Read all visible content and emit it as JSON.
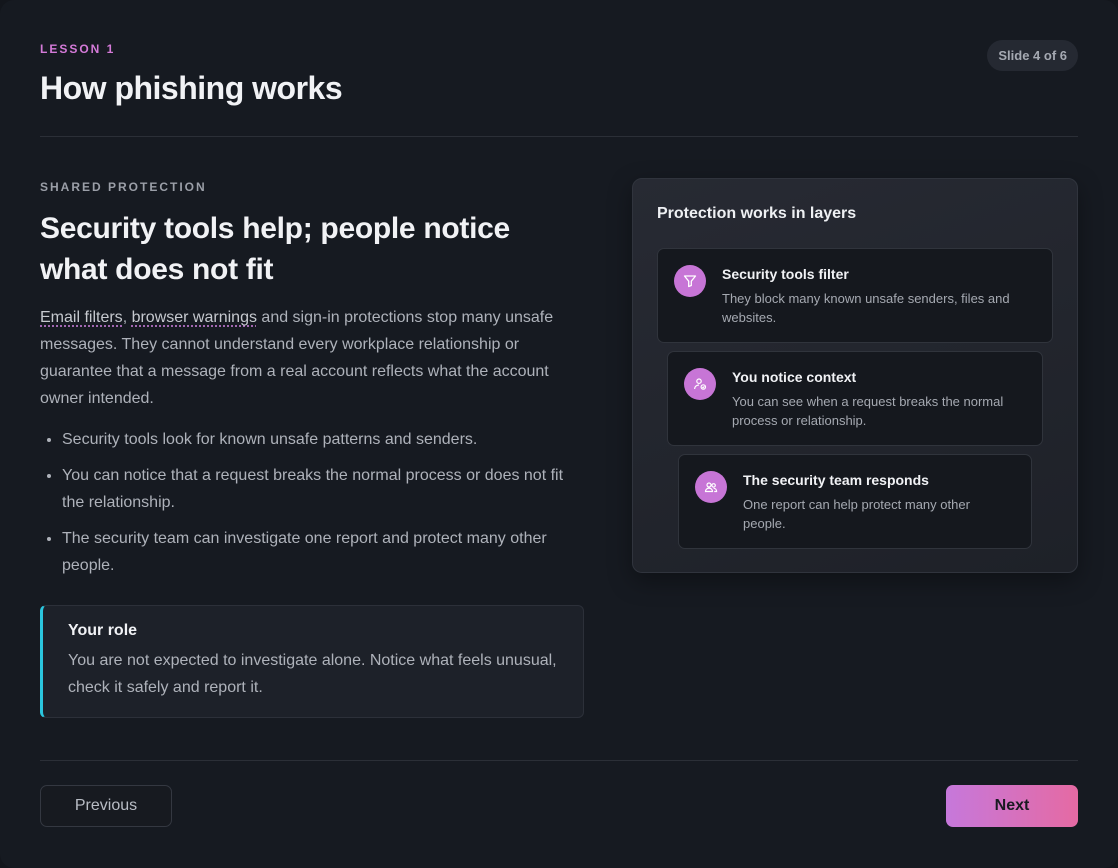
{
  "header": {
    "lesson_label": "LESSON 1",
    "title": "How phishing works",
    "slide_indicator": "Slide 4 of 6"
  },
  "content": {
    "section_label": "SHARED PROTECTION",
    "section_title": "Security tools help; people notice what does not fit",
    "intro": {
      "term_1": "Email filters",
      "separator": ", ",
      "term_2": "browser warnings",
      "rest": " and sign-in protections stop many unsafe messages. They cannot understand every workplace relationship or guarantee that a message from a real account reflects what the account owner intended."
    },
    "bullets": [
      "Security tools look for known unsafe patterns and senders.",
      "You can notice that a request breaks the normal process or does not fit the relationship.",
      "The security team can investigate one report and protect many other people."
    ],
    "role_box": {
      "title": "Your role",
      "text": "You are not expected to investigate alone. Notice what feels unusual, check it safely and report it."
    }
  },
  "panel": {
    "title": "Protection works in layers",
    "layers": [
      {
        "icon": "filter-icon",
        "title": "Security tools filter",
        "description": "They block many known unsafe senders, files and websites."
      },
      {
        "icon": "user-check-icon",
        "title": "You notice context",
        "description": "You can see when a request breaks the normal process or relationship."
      },
      {
        "icon": "users-icon",
        "title": "The security team responds",
        "description": "One report can help protect many other people."
      }
    ]
  },
  "nav": {
    "previous_label": "Previous",
    "next_label": "Next"
  },
  "colors": {
    "accent": "#c775d6",
    "callout_border": "#2bc6de",
    "next_gradient_start": "#c678db",
    "next_gradient_end": "#e56aa3"
  }
}
